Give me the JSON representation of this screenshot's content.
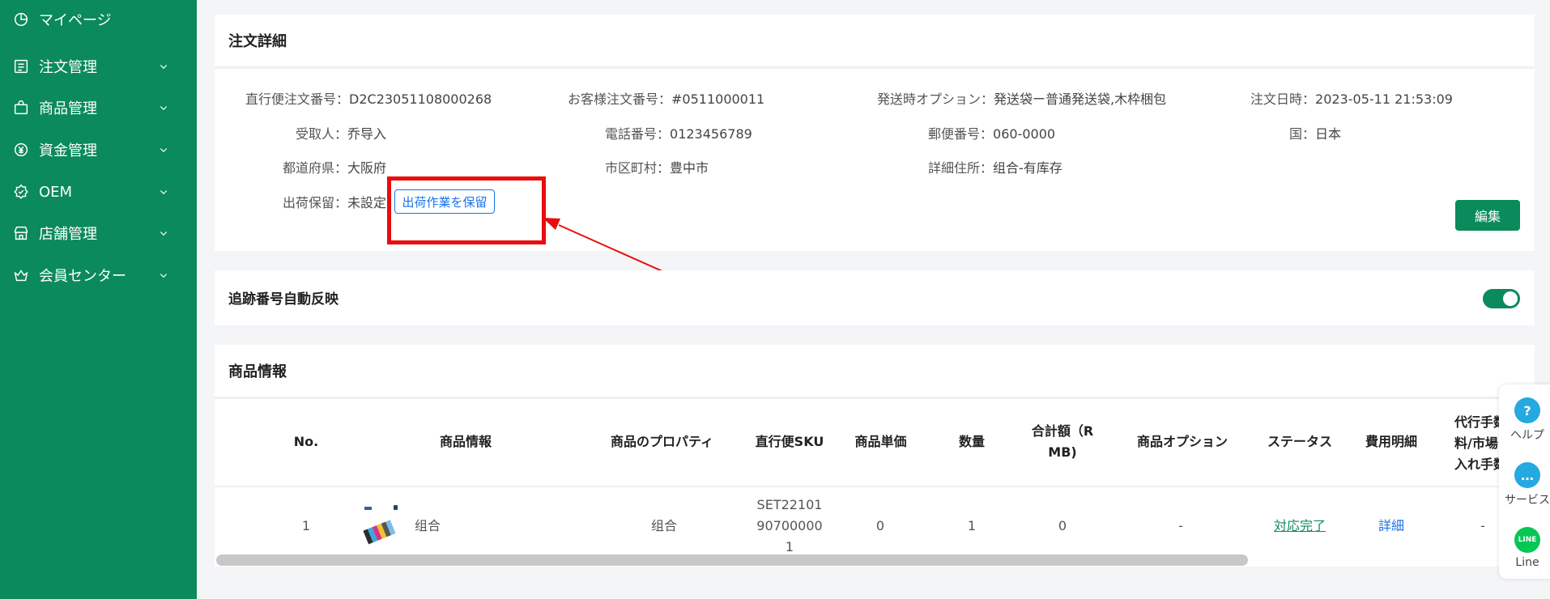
{
  "sidebar": {
    "items": [
      {
        "label": "マイページ",
        "icon": "chart-pie-icon",
        "has_children": false
      },
      {
        "label": "注文管理",
        "icon": "order-list-icon",
        "has_children": true
      },
      {
        "label": "商品管理",
        "icon": "shopping-bag-icon",
        "has_children": true
      },
      {
        "label": "資金管理",
        "icon": "yen-coin-icon",
        "has_children": true
      },
      {
        "label": "OEM",
        "icon": "badge-icon",
        "has_children": true
      },
      {
        "label": "店舗管理",
        "icon": "store-icon",
        "has_children": true
      },
      {
        "label": "会員センター",
        "icon": "crown-icon",
        "has_children": true
      }
    ]
  },
  "order_detail": {
    "title": "注文詳細",
    "fields": {
      "direct_order_no": {
        "label": "直行便注文番号：",
        "value": "D2C23051108000268"
      },
      "customer_order_no": {
        "label": "お客様注文番号：",
        "value": "#0511000011"
      },
      "shipping_option": {
        "label": "発送時オプション：",
        "value": "発送袋ー普通発送袋,木枠梱包"
      },
      "order_date": {
        "label": "注文日時：",
        "value": "2023-05-11 21:53:09"
      },
      "recipient": {
        "label": "受取人：",
        "value": "乔导入"
      },
      "phone": {
        "label": "電話番号：",
        "value": "0123456789"
      },
      "postal_code": {
        "label": "郵便番号：",
        "value": "060-0000"
      },
      "country": {
        "label": "国：",
        "value": "日本"
      },
      "prefecture": {
        "label": "都道府県：",
        "value": "大阪府"
      },
      "city": {
        "label": "市区町村：",
        "value": "豊中市"
      },
      "address": {
        "label": "詳細住所：",
        "value": "组合-有库存"
      },
      "shipping_hold": {
        "label": "出荷保留：",
        "value": "未設定"
      }
    },
    "hold_button": "出荷作業を保留",
    "edit_button": "編集"
  },
  "tracking": {
    "title": "追跡番号自動反映",
    "toggle_on": true
  },
  "product_info": {
    "title": "商品情報",
    "columns": [
      "No.",
      "商品情報",
      "商品のプロパティ",
      "直行便SKU",
      "商品単価",
      "数量",
      [
        "合計額（R",
        "MB)"
      ],
      "商品オプション",
      "ステータス",
      "費用明細",
      [
        "代行手数",
        "料/市場",
        "入れ手数"
      ]
    ],
    "rows": [
      {
        "no": "1",
        "name": "组合",
        "property": "组合",
        "sku_lines": [
          "SET22101",
          "90700000",
          "1"
        ],
        "unit_price": "0",
        "quantity": "1",
        "total": "0",
        "option": "-",
        "status": "対応完了",
        "fee_detail": "詳細",
        "fee": "-"
      }
    ]
  },
  "float_tools": [
    {
      "label": "ヘルプ",
      "icon": "help-icon",
      "color": "#26a8e0"
    },
    {
      "label": "サービス",
      "icon": "chat-icon",
      "color": "#26a8e0"
    },
    {
      "label": "Line",
      "icon": "line-icon",
      "color": "#06c755",
      "icon_text": "LINE"
    }
  ],
  "colors": {
    "brand_green": "#0b8a5c",
    "link_blue": "#1a73e8",
    "highlight_red": "#ea0c0c"
  }
}
